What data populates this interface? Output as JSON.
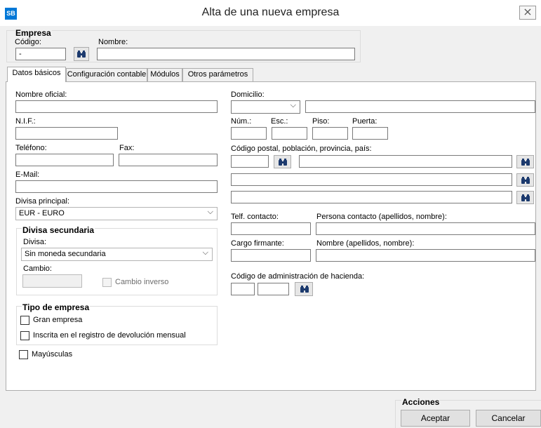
{
  "window": {
    "app_icon_label": "SB",
    "title": "Alta de una nueva empresa",
    "close_glyph": "⨯"
  },
  "empresa": {
    "group_title": "Empresa",
    "codigo_label": "Código:",
    "codigo_value": "-",
    "nombre_label": "Nombre:",
    "nombre_value": ""
  },
  "tabs": [
    {
      "label": "Datos básicos",
      "active": true
    },
    {
      "label": "Configuración contable",
      "active": false
    },
    {
      "label": "Módulos",
      "active": false
    },
    {
      "label": "Otros parámetros",
      "active": false
    }
  ],
  "basicos": {
    "nombre_oficial_label": "Nombre oficial:",
    "nif_label": "N.I.F.:",
    "telefono_label": "Teléfono:",
    "fax_label": "Fax:",
    "email_label": "E-Mail:",
    "divisa_principal_label": "Divisa principal:",
    "divisa_principal_value": "EUR - EURO",
    "divisa_secundaria": {
      "group_title": "Divisa secundaria",
      "divisa_label": "Divisa:",
      "divisa_value": "Sin moneda secundaria",
      "cambio_label": "Cambio:",
      "cambio_inverso_label": "Cambio inverso"
    },
    "tipo_empresa": {
      "group_title": "Tipo de empresa",
      "gran_empresa_label": "Gran empresa",
      "inscrita_label": "Inscrita en el registro de devolución mensual"
    },
    "mayusculas_label": "Mayúsculas",
    "domicilio_label": "Domicilio:",
    "num_label": "Núm.:",
    "esc_label": "Esc.:",
    "piso_label": "Piso:",
    "puerta_label": "Puerta:",
    "cp_label": "Código postal, población, provincia, país:",
    "telf_contacto_label": "Telf. contacto:",
    "persona_contacto_label": "Persona contacto (apellidos, nombre):",
    "cargo_firmante_label": "Cargo firmante:",
    "nombre_firmante_label": "Nombre (apellidos, nombre):",
    "cod_hacienda_label": "Código de administración de hacienda:"
  },
  "acciones": {
    "group_title": "Acciones",
    "aceptar_label": "Aceptar",
    "cancelar_label": "Cancelar"
  }
}
